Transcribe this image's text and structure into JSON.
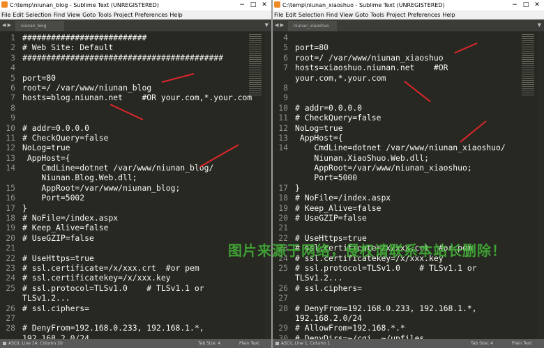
{
  "left_window": {
    "title": "C:\\temp\\niunan_blog - Sublime Text (UNREGISTERED)",
    "tab_label": "niunan_blog",
    "lines": [
      {
        "n": "1",
        "t": "##########################"
      },
      {
        "n": "2",
        "t": "# Web Site: Default"
      },
      {
        "n": "3",
        "t": "##########################################"
      },
      {
        "n": "4",
        "t": ""
      },
      {
        "n": "5",
        "t": "port=80"
      },
      {
        "n": "6",
        "t": "root=/ /var/www/niunan_blog"
      },
      {
        "n": "7",
        "t": "hosts=blog.niunan.net    #OR your.com,*.your.com"
      },
      {
        "n": "8",
        "t": ""
      },
      {
        "n": "9",
        "t": ""
      },
      {
        "n": "10",
        "t": "# addr=0.0.0.0"
      },
      {
        "n": "11",
        "t": "# CheckQuery=false"
      },
      {
        "n": "12",
        "t": "NoLog=true"
      },
      {
        "n": "13",
        "t": " AppHost={"
      },
      {
        "n": "14",
        "t": "    CmdLine=dotnet /var/www/niunan_blog/"
      },
      {
        "n": "",
        "t": "    Niunan.Blog.Web.dll;"
      },
      {
        "n": "15",
        "t": "    AppRoot=/var/www/niunan_blog;"
      },
      {
        "n": "16",
        "t": "    Port=5002"
      },
      {
        "n": "17",
        "t": "}"
      },
      {
        "n": "18",
        "t": "# NoFile=/index.aspx"
      },
      {
        "n": "19",
        "t": "# Keep_Alive=false"
      },
      {
        "n": "20",
        "t": "# UseGZIP=false"
      },
      {
        "n": "21",
        "t": ""
      },
      {
        "n": "22",
        "t": "# UseHttps=true"
      },
      {
        "n": "23",
        "t": "# ssl.certificate=/x/xxx.crt  #or pem"
      },
      {
        "n": "24",
        "t": "# ssl.certificatekey=/x/xxx.key"
      },
      {
        "n": "25",
        "t": "# ssl.protocol=TLSv1.0    # TLSv1.1 or"
      },
      {
        "n": "",
        "t": "TLSv1.2..."
      },
      {
        "n": "26",
        "t": "# ssl.ciphers="
      },
      {
        "n": "27",
        "t": ""
      },
      {
        "n": "28",
        "t": "# DenyFrom=192.168.0.233, 192.168.1.*,"
      },
      {
        "n": "",
        "t": "192.168.2.0/24"
      }
    ],
    "status": {
      "position": "ASCII, Line 14, Column 20",
      "tab_size": "Tab Size: 4",
      "syntax": "Plain Text"
    }
  },
  "right_window": {
    "title": "C:\\temp\\niunan_xiaoshuo - Sublime Text (UNREGISTERED)",
    "tab_label": "niunan_xiaoshuo",
    "lines": [
      {
        "n": "4",
        "t": ""
      },
      {
        "n": "5",
        "t": "port=80"
      },
      {
        "n": "6",
        "t": "root=/ /var/www/niunan_xiaoshuo"
      },
      {
        "n": "7",
        "t": "hosts=xiaoshuo.niunan.net    #OR"
      },
      {
        "n": "",
        "t": "your.com,*.your.com"
      },
      {
        "n": "8",
        "t": ""
      },
      {
        "n": "9",
        "t": ""
      },
      {
        "n": "10",
        "t": "# addr=0.0.0.0"
      },
      {
        "n": "11",
        "t": "# CheckQuery=false"
      },
      {
        "n": "12",
        "t": "NoLog=true"
      },
      {
        "n": "13",
        "t": " AppHost={"
      },
      {
        "n": "14",
        "t": "    CmdLine=dotnet /var/www/niunan_xiaoshuo/"
      },
      {
        "n": "",
        "t": "    Niunan.XiaoShuo.Web.dll;"
      },
      {
        "n": "",
        "t": "    AppRoot=/var/www/niunan_xiaoshuo;"
      },
      {
        "n": "",
        "t": "    Port=5000"
      },
      {
        "n": "17",
        "t": "}"
      },
      {
        "n": "18",
        "t": "# NoFile=/index.aspx"
      },
      {
        "n": "19",
        "t": "# Keep_Alive=false"
      },
      {
        "n": "20",
        "t": "# UseGZIP=false"
      },
      {
        "n": "21",
        "t": ""
      },
      {
        "n": "22",
        "t": "# UseHttps=true"
      },
      {
        "n": "23",
        "t": "# ssl.certificate=/x/xxx.crt  #or pem"
      },
      {
        "n": "24",
        "t": "# ssl.certificatekey=/x/xxx.key"
      },
      {
        "n": "25",
        "t": "# ssl.protocol=TLSv1.0    # TLSv1.1 or"
      },
      {
        "n": "",
        "t": "TLSv1.2..."
      },
      {
        "n": "26",
        "t": "# ssl.ciphers="
      },
      {
        "n": "27",
        "t": ""
      },
      {
        "n": "28",
        "t": "# DenyFrom=192.168.0.233, 192.168.1.*,"
      },
      {
        "n": "",
        "t": "192.168.2.0/24"
      },
      {
        "n": "29",
        "t": "# AllowFrom=192.168.*.*"
      },
      {
        "n": "30",
        "t": "# DenyDirs=~/cgi, ~/upfiles"
      }
    ],
    "status": {
      "position": "ASCII, Line 1, Column 1",
      "tab_size": "Tab Size: 4",
      "syntax": "Plain Text"
    }
  },
  "menu_items": [
    "File",
    "Edit",
    "Selection",
    "Find",
    "View",
    "Goto",
    "Tools",
    "Project",
    "Preferences",
    "Help"
  ],
  "window_controls": [
    "−",
    "□",
    "✕"
  ],
  "watermark": "图片来源于网络，侵权请联系本站长删除！",
  "colors": {
    "editor_bg": "#272822",
    "text": "#f8f8f2",
    "line_number": "#8f908a",
    "arrow": "#e0262b",
    "watermark": "#46c13a"
  }
}
